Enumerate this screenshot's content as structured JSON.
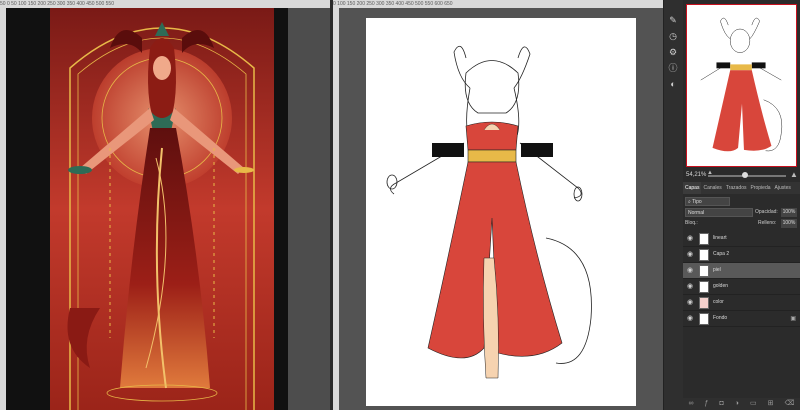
{
  "left_document": {
    "ruler_numbers": "50 0 50 100 150 200 250 300 350 400 450 500 550"
  },
  "right_document": {
    "ruler_numbers": "0 100 150 200 250 300 350 400 450 500 550 600 650"
  },
  "navigator": {
    "zoom": "54,21%"
  },
  "layers_panel": {
    "tabs": [
      "Capas",
      "Canales",
      "Trazados",
      "Propieda",
      "Ajustes"
    ],
    "active_tab": "Capas",
    "filter_kind": "Tipo",
    "blend_mode": "Normal",
    "opacity_label": "Opacidad:",
    "opacity_value": "100%",
    "lock_label": "Bloq.:",
    "fill_label": "Relleno:",
    "fill_value": "100%",
    "layers": [
      {
        "name": "lineart",
        "selected": false
      },
      {
        "name": "Capa 2",
        "selected": false
      },
      {
        "name": "piel",
        "selected": true
      },
      {
        "name": "golden",
        "selected": false
      },
      {
        "name": "color",
        "selected": false
      },
      {
        "name": "Fondo",
        "selected": false
      }
    ]
  },
  "colors": {
    "accent_red": "#d8463b",
    "panel_dark": "#2b2b2b",
    "selection": "#595959",
    "gold": "#e8b948"
  }
}
